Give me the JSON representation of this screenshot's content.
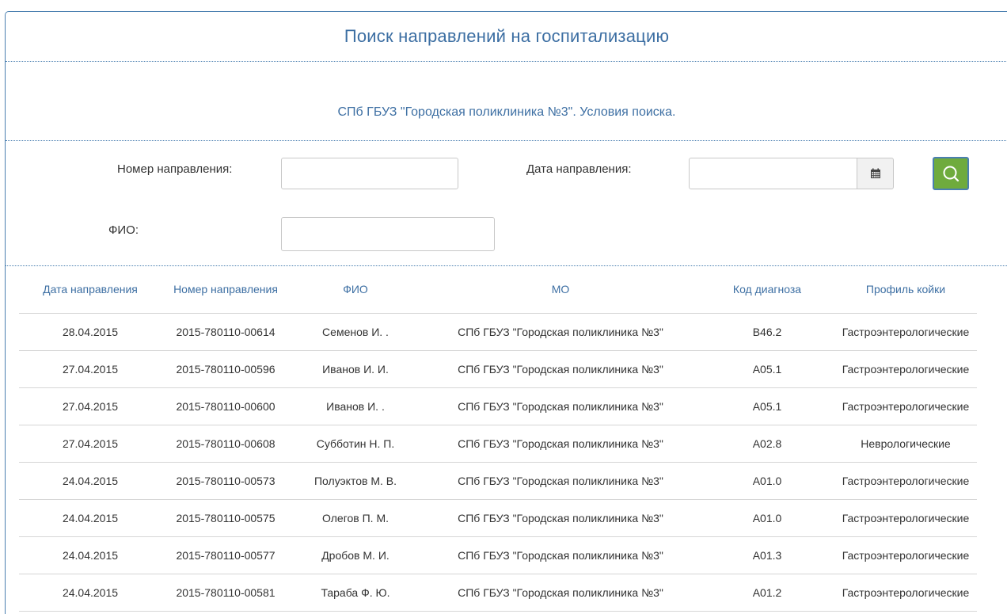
{
  "page": {
    "title": "Поиск направлений на госпитализацию",
    "subtitle": "СПб ГБУЗ \"Городская поликлиника №3\". Условия поиска."
  },
  "search": {
    "number_label": "Номер направления:",
    "number_value": "",
    "date_label": "Дата направления:",
    "date_value": "",
    "fio_label": "ФИО:",
    "fio_value": "",
    "calendar_icon": "calendar-icon",
    "search_icon": "search-icon",
    "search_button_color": "#6fab3d"
  },
  "table": {
    "headers": [
      "Дата направления",
      "Номер направления",
      "ФИО",
      "МО",
      "Код диагноза",
      "Профиль койки"
    ],
    "rows": [
      [
        "28.04.2015",
        "2015-780110-00614",
        "Семенов И. .",
        "СПб ГБУЗ \"Городская поликлиника №3\"",
        "B46.2",
        "Гастроэнтерологические"
      ],
      [
        "27.04.2015",
        "2015-780110-00596",
        "Иванов И. И.",
        "СПб ГБУЗ \"Городская поликлиника №3\"",
        "A05.1",
        "Гастроэнтерологические"
      ],
      [
        "27.04.2015",
        "2015-780110-00600",
        "Иванов И. .",
        "СПб ГБУЗ \"Городская поликлиника №3\"",
        "A05.1",
        "Гастроэнтерологические"
      ],
      [
        "27.04.2015",
        "2015-780110-00608",
        "Субботин Н. П.",
        "СПб ГБУЗ \"Городская поликлиника №3\"",
        "A02.8",
        "Неврологические"
      ],
      [
        "24.04.2015",
        "2015-780110-00573",
        "Полуэктов М. В.",
        "СПб ГБУЗ \"Городская поликлиника №3\"",
        "A01.0",
        "Гастроэнтерологические"
      ],
      [
        "24.04.2015",
        "2015-780110-00575",
        "Олегов П. М.",
        "СПб ГБУЗ \"Городская поликлиника №3\"",
        "A01.0",
        "Гастроэнтерологические"
      ],
      [
        "24.04.2015",
        "2015-780110-00577",
        "Дробов М. И.",
        "СПб ГБУЗ \"Городская поликлиника №3\"",
        "A01.3",
        "Гастроэнтерологические"
      ],
      [
        "24.04.2015",
        "2015-780110-00581",
        "Тараба Ф. Ю.",
        "СПб ГБУЗ \"Городская поликлиника №3\"",
        "A01.2",
        "Гастроэнтерологические"
      ]
    ]
  }
}
